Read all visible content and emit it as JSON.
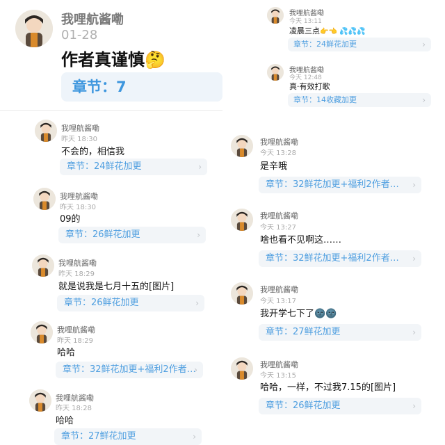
{
  "header": {
    "name": "我哩航酱嘞",
    "date": "01-28",
    "title": "作者真谨慎",
    "title_emoji": "🤔",
    "chapter": "章节：7"
  },
  "left_cards": [
    {
      "name": "我哩航酱嘞",
      "time": "昨天 18:30",
      "msg": "不会的，相信我",
      "chapter": "章节：24鲜花加更"
    },
    {
      "name": "我哩航酱嘞",
      "time": "昨天 18:30",
      "msg": "09的",
      "chapter": "章节：26鲜花加更"
    },
    {
      "name": "我哩航酱嘞",
      "time": "昨天 18:29",
      "msg": "就是说我是七月十五的[图片]",
      "chapter": "章节：26鲜花加更"
    },
    {
      "name": "我哩航酱嘞",
      "time": "昨天 18:29",
      "msg": "哈哈",
      "chapter": "章节：32鲜花加更+福利2作者…"
    },
    {
      "name": "我哩航酱嘞",
      "time": "昨天 18:28",
      "msg": "哈哈",
      "chapter": "章节：27鲜花加更"
    }
  ],
  "right_top_cards": [
    {
      "name": "我哩航酱嘞",
      "time": "今天 13:11",
      "msg": "凌晨三点",
      "msg_emoji": "👉👈 💦💦💦",
      "chapter": "章节：24鲜花加更"
    },
    {
      "name": "我哩航酱嘞",
      "time": "今天 12:48",
      "msg": "真·有效打歌",
      "chapter": "章节：14收藏加更"
    }
  ],
  "right_cards": [
    {
      "name": "我哩航酱嘞",
      "time": "今天 13:28",
      "msg": "是辛哦",
      "chapter": "章节：32鲜花加更+福利2作者…"
    },
    {
      "name": "我哩航酱嘞",
      "time": "今天 13:27",
      "msg": "啥也看不见啊这……",
      "chapter": "章节：32鲜花加更+福利2作者…"
    },
    {
      "name": "我哩航酱嘞",
      "time": "今天 13:17",
      "msg": "我开学七下了",
      "msg_emoji": "🌚🌚",
      "chapter": "章节：27鲜花加更"
    },
    {
      "name": "我哩航酱嘞",
      "time": "今天 13:15",
      "msg": "哈哈，一样，不过我7.15的[图片]",
      "chapter": "章节：26鲜花加更"
    }
  ],
  "icons": {
    "avatar": "avatar-boy-photo",
    "chevron": "chevron-right-icon"
  },
  "colors": {
    "chapter_text": "#4f9fe0",
    "chapter_bg": "#f2f5f8"
  }
}
